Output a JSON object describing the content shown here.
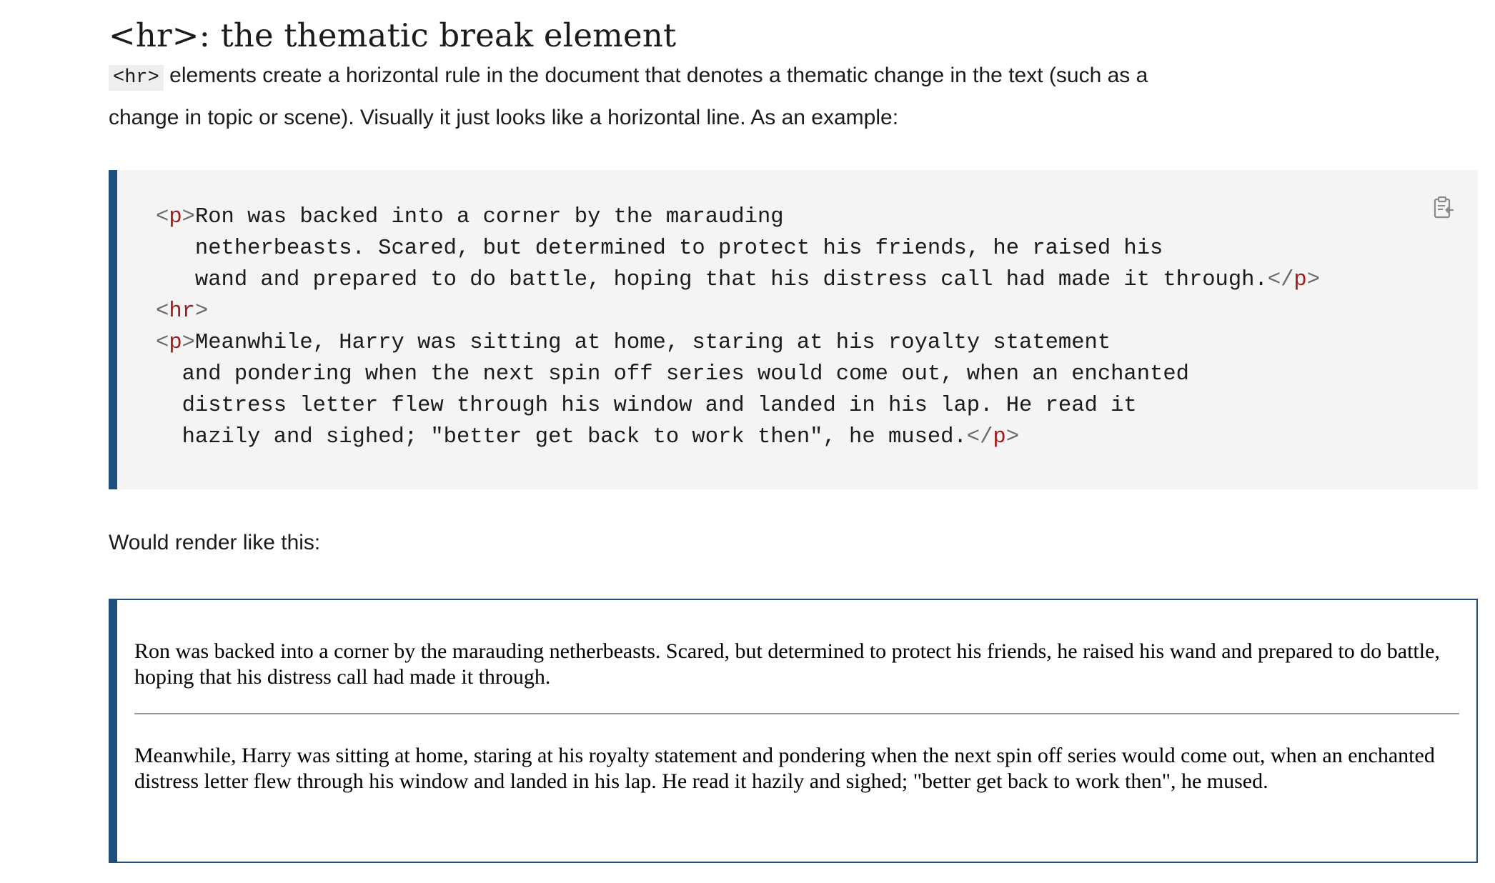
{
  "section": {
    "title": "<hr>: the thematic break element",
    "intro_code": "<hr>",
    "intro_text": " elements create a horizontal rule in the document that denotes a thematic change in the text (such as a change in topic or scene). Visually it just looks like a horizontal line. As an example:"
  },
  "code_example": {
    "copy_icon": "clipboard-icon",
    "tag_color": "#a01c1c",
    "accent_color": "#1f4f7a",
    "lines": [
      {
        "indent": "",
        "open": "<",
        "tag": "p",
        "close": ">",
        "text": "Ron was backed into a corner by the marauding",
        "end_open": "",
        "end_tag": "",
        "end_close": ""
      },
      {
        "indent": "   ",
        "open": "",
        "tag": "",
        "close": "",
        "text": "netherbeasts. Scared, but determined to protect his friends, he raised his",
        "end_open": "",
        "end_tag": "",
        "end_close": ""
      },
      {
        "indent": "   ",
        "open": "",
        "tag": "",
        "close": "",
        "text": "wand and prepared to do battle, hoping that his distress call had made it through.",
        "end_open": "</",
        "end_tag": "p",
        "end_close": ">"
      },
      {
        "indent": "",
        "open": "<",
        "tag": "hr",
        "close": ">",
        "text": "",
        "end_open": "",
        "end_tag": "",
        "end_close": ""
      },
      {
        "indent": "",
        "open": "<",
        "tag": "p",
        "close": ">",
        "text": "Meanwhile, Harry was sitting at home, staring at his royalty statement",
        "end_open": "",
        "end_tag": "",
        "end_close": ""
      },
      {
        "indent": "  ",
        "open": "",
        "tag": "",
        "close": "",
        "text": "and pondering when the next spin off series would come out, when an enchanted",
        "end_open": "",
        "end_tag": "",
        "end_close": ""
      },
      {
        "indent": "  ",
        "open": "",
        "tag": "",
        "close": "",
        "text": "distress letter flew through his window and landed in his lap. He read it",
        "end_open": "",
        "end_tag": "",
        "end_close": ""
      },
      {
        "indent": "  ",
        "open": "",
        "tag": "",
        "close": "",
        "text": "hazily and sighed; \"better get back to work then\", he mused.",
        "end_open": "</",
        "end_tag": "p",
        "end_close": ">"
      }
    ]
  },
  "render_label": "Would render like this:",
  "rendered": {
    "paragraph1": "Ron was backed into a corner by the marauding netherbeasts. Scared, but determined to protect his friends, he raised his wand and prepared to do battle, hoping that his distress call had made it through.",
    "paragraph2": "Meanwhile, Harry was sitting at home, staring at his royalty statement and pondering when the next spin off series would come out, when an enchanted distress letter flew through his window and landed in his lap. He read it hazily and sighed; \"better get back to work then\", he mused."
  }
}
